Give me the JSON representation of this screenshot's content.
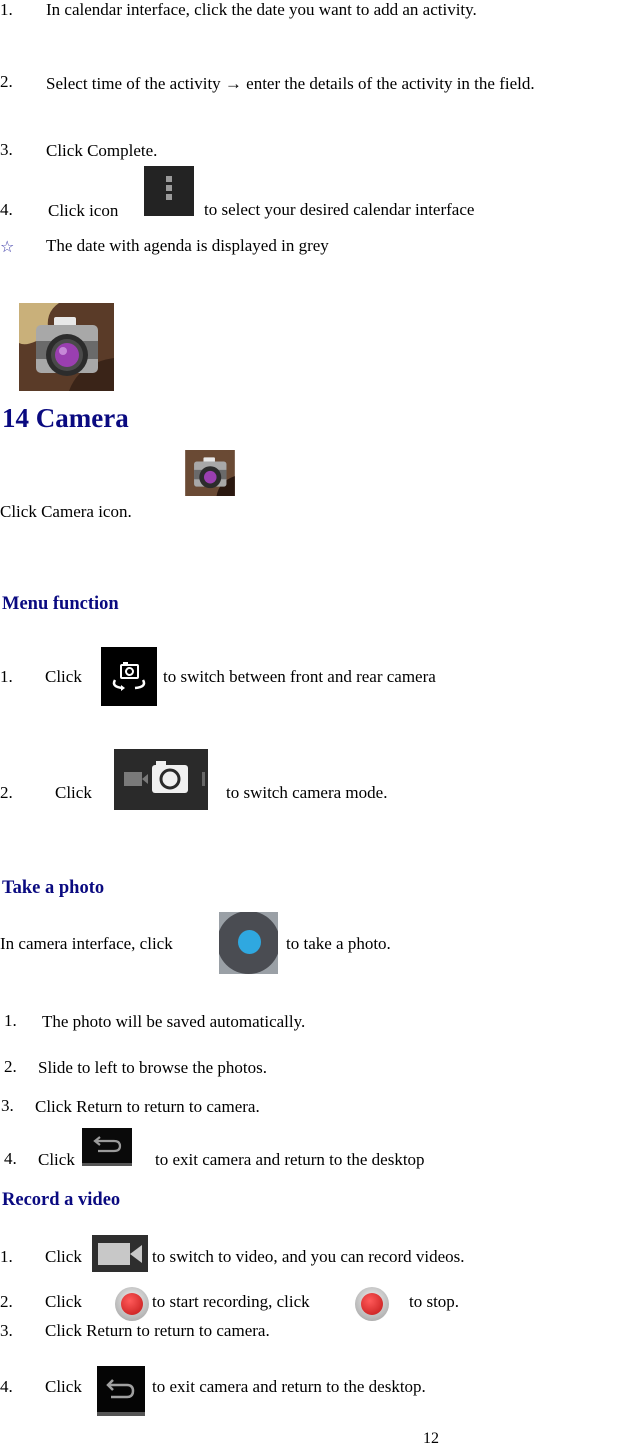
{
  "calendar_steps": [
    {
      "num": "1.",
      "text": "In calendar interface, click the date you want to add an activity."
    },
    {
      "num": "2.",
      "text": "Select time of the activity → enter the details of the activity in the field."
    },
    {
      "num": "3.",
      "text": "Click Complete."
    },
    {
      "num": "4.",
      "before": "Click icon",
      "icon": "overflow-menu-icon",
      "after": "to select your desired calendar interface"
    }
  ],
  "note": {
    "bullet": "☆",
    "text": "The date with agenda is displayed in grey"
  },
  "section": {
    "title": "14 Camera",
    "icon": "camera-app-icon"
  },
  "intro": {
    "text": "Click Camera icon.",
    "icon": "camera-app-icon"
  },
  "menu_function": {
    "title": "Menu function",
    "items": [
      {
        "num": "1.",
        "before": "Click",
        "icon": "switch-camera-icon",
        "after": "to switch between front and rear camera"
      },
      {
        "num": "2.",
        "before": "Click",
        "icon": "camera-mode-icon",
        "after": "to switch camera mode."
      }
    ]
  },
  "take_photo": {
    "title": "Take a photo",
    "intro_before": "In camera interface, click",
    "intro_icon": "shutter-button-icon",
    "intro_after": "to take a photo.",
    "steps": [
      {
        "num": "1.",
        "text": "The photo will be saved automatically."
      },
      {
        "num": "2.",
        "text": "Slide to left to browse the photos."
      },
      {
        "num": "3.",
        "text": "Click Return to return to camera."
      },
      {
        "num": "4.",
        "before": "Click",
        "icon": "back-icon",
        "after": "to exit camera and return to the desktop"
      }
    ]
  },
  "record_video": {
    "title": "Record a video",
    "steps": [
      {
        "num": "1.",
        "before": "Click",
        "icon": "video-camera-icon",
        "after": "to switch to video, and you can record videos."
      },
      {
        "num": "2.",
        "before": "Click",
        "icon": "record-button-icon",
        "middle": "to start recording, click",
        "icon2": "stop-button-icon",
        "after": "to stop."
      },
      {
        "num": "3.",
        "text": "Click Return to return to camera."
      },
      {
        "num": "4.",
        "before": "Click",
        "icon": "back-icon",
        "after": "to exit camera and return to the desktop."
      }
    ]
  },
  "page_number": "12",
  "colors": {
    "heading": "#0a0a80",
    "shutter_blue": "#2fa8e0",
    "record_red": "#cc1f1f"
  }
}
